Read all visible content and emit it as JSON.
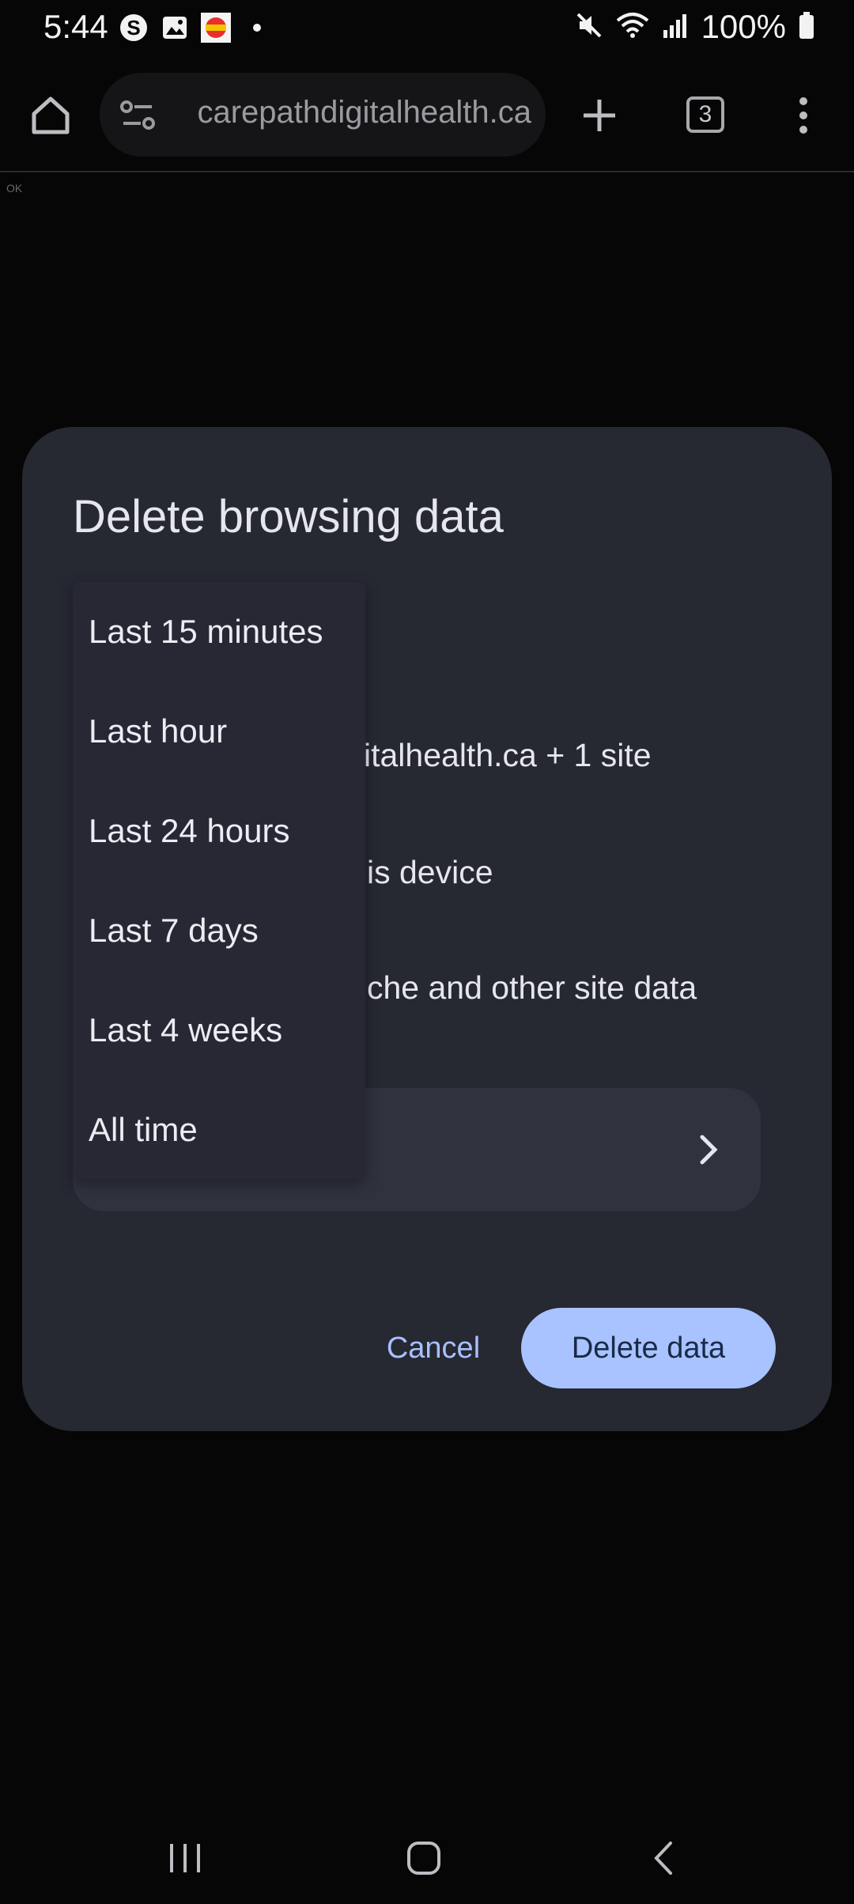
{
  "status_bar": {
    "time": "5:44",
    "battery": "100%",
    "left_icons": [
      "s-icon",
      "gallery-icon",
      "app-badge-icon",
      "dot-icon"
    ],
    "right_icons": [
      "mute-icon",
      "wifi-icon",
      "signal-icon",
      "battery-icon"
    ]
  },
  "toolbar": {
    "url": "carepathdigitalhealth.ca",
    "tab_count": "3"
  },
  "page": {
    "ok_text": "OK"
  },
  "dialog": {
    "title": "Delete browsing data",
    "row_sites": "italhealth.ca + 1 site",
    "row_device": "is device",
    "row_cache": "che and other site data",
    "cancel_label": "Cancel",
    "delete_label": "Delete data"
  },
  "menu": {
    "items": [
      "Last 15 minutes",
      "Last hour",
      "Last 24 hours",
      "Last 7 days",
      "Last 4 weeks",
      "All time"
    ]
  },
  "colors": {
    "dialog_bg": "#262832",
    "accent": "#a8c3ff",
    "link": "#a8c0ff"
  }
}
